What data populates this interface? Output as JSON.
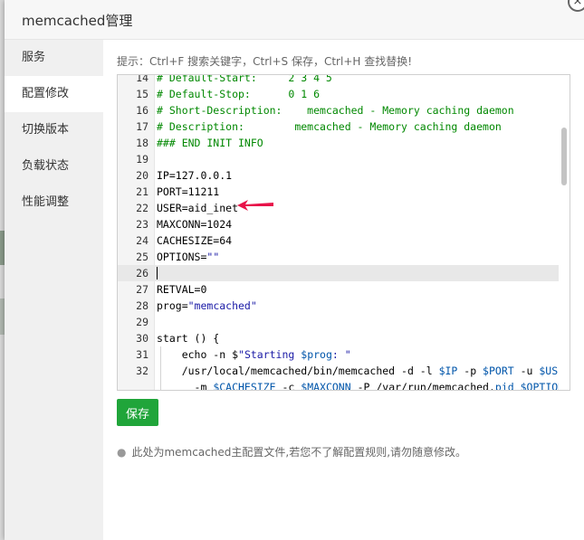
{
  "dialog": {
    "title": "memcached管理",
    "close_glyph": "×"
  },
  "sidebar": {
    "items": [
      {
        "label": "服务",
        "active": false
      },
      {
        "label": "配置修改",
        "active": true
      },
      {
        "label": "切换版本",
        "active": false
      },
      {
        "label": "负载状态",
        "active": false
      },
      {
        "label": "性能调整",
        "active": false
      }
    ]
  },
  "editor": {
    "tip": "提示：Ctrl+F 搜索关键字，Ctrl+S 保存，Ctrl+H 查找替换!",
    "active_line": 26,
    "lines": [
      {
        "n": "14",
        "segs": [
          {
            "t": "# Default-Start:     2 3 4 5",
            "c": "cmt"
          }
        ]
      },
      {
        "n": "15",
        "segs": [
          {
            "t": "# Default-Stop:      0 1 6",
            "c": "cmt"
          }
        ]
      },
      {
        "n": "16",
        "segs": [
          {
            "t": "# Short-Description:    memcached - Memory caching daemon",
            "c": "cmt"
          }
        ]
      },
      {
        "n": "17",
        "segs": [
          {
            "t": "# Description:        memcached - Memory caching daemon",
            "c": "cmt"
          }
        ]
      },
      {
        "n": "18",
        "segs": [
          {
            "t": "### END INIT INFO",
            "c": "cmt"
          }
        ]
      },
      {
        "n": "19",
        "segs": []
      },
      {
        "n": "20",
        "segs": [
          {
            "t": "IP=127.0.0.1",
            "c": ""
          }
        ]
      },
      {
        "n": "21",
        "segs": [
          {
            "t": "PORT=11211",
            "c": ""
          }
        ]
      },
      {
        "n": "22",
        "segs": [
          {
            "t": "USER=aid_inet",
            "c": ""
          }
        ]
      },
      {
        "n": "23",
        "segs": [
          {
            "t": "MAXCONN=1024",
            "c": ""
          }
        ]
      },
      {
        "n": "24",
        "segs": [
          {
            "t": "CACHESIZE=64",
            "c": ""
          }
        ]
      },
      {
        "n": "25",
        "segs": [
          {
            "t": "OPTIONS=",
            "c": ""
          },
          {
            "t": "\"\"",
            "c": "str"
          }
        ]
      },
      {
        "n": "26",
        "segs": []
      },
      {
        "n": "27",
        "segs": [
          {
            "t": "RETVAL=0",
            "c": ""
          }
        ]
      },
      {
        "n": "28",
        "segs": [
          {
            "t": "prog=",
            "c": ""
          },
          {
            "t": "\"memcached\"",
            "c": "str"
          }
        ]
      },
      {
        "n": "29",
        "segs": []
      },
      {
        "n": "30",
        "segs": [
          {
            "t": "start () {",
            "c": ""
          }
        ]
      },
      {
        "n": "31",
        "segs": [
          {
            "t": "    echo -n $",
            "c": ""
          },
          {
            "t": "\"Starting ",
            "c": "str"
          },
          {
            "t": "$prog",
            "c": "var"
          },
          {
            "t": ": \"",
            "c": "str"
          }
        ]
      },
      {
        "n": "32",
        "segs": [
          {
            "t": "    /usr/local/memcached/bin/memcached -d -l ",
            "c": ""
          },
          {
            "t": "$IP",
            "c": "var"
          },
          {
            "t": " -p ",
            "c": ""
          },
          {
            "t": "$PORT",
            "c": "var"
          },
          {
            "t": " -u ",
            "c": ""
          },
          {
            "t": "$USER",
            "c": "var"
          }
        ]
      },
      {
        "n": "",
        "segs": [
          {
            "t": "      -m ",
            "c": ""
          },
          {
            "t": "$CACHESIZE",
            "c": "var"
          },
          {
            "t": " -c ",
            "c": ""
          },
          {
            "t": "$MAXCONN",
            "c": "var"
          },
          {
            "t": " -P /var/run/memcached.",
            "c": ""
          },
          {
            "t": "pid",
            "c": "var"
          },
          {
            "t": " ",
            "c": ""
          },
          {
            "t": "$OPTIONS",
            "c": "var"
          }
        ]
      }
    ]
  },
  "save_button": {
    "label": "保存"
  },
  "note": {
    "bullet": "●",
    "text": "此处为memcached主配置文件,若您不了解配置规则,请勿随意修改。"
  },
  "colors": {
    "accent": "#20a53a",
    "comment": "#008800",
    "string": "#1a1aa6",
    "variable": "#0055aa",
    "arrow": "#e8134a"
  }
}
